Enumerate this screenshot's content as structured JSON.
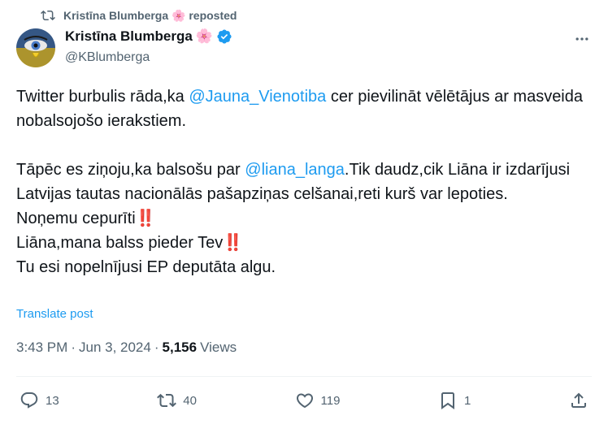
{
  "repost": {
    "text": "Kristīna Blumberga 🌸 reposted",
    "icon": "repost-icon"
  },
  "author": {
    "name": "Kristīna Blumberga",
    "name_emoji": "🌸",
    "verified_icon": "verified-badge-icon",
    "handle": "@KBlumberga"
  },
  "tweet": {
    "line1_a": "Twitter burbulis rāda,ka ",
    "mention1": "@Jauna_Vienotiba",
    "line1_b": " cer pievilināt vēlētājus ar masveida nobalsojošo ierakstiem.",
    "line2_a": "Tāpēc es ziņoju,ka balsošu par ",
    "mention2": "@liana_langa",
    "line2_b": ".Tik daudz,cik Liāna ir izdarījusi Latvijas tautas nacionālās pašapziņas celšanai,reti kurš var lepoties.",
    "line3": "Noņemu cepurīti",
    "line4": "Liāna,mana balss pieder Tev",
    "line5": "Tu esi nopelnījusi EP deputāta algu.",
    "emphasis": "‼️"
  },
  "translate_label": "Translate post",
  "meta": {
    "time": "3:43 PM",
    "sep": "·",
    "date": "Jun 3, 2024",
    "views_count": "5,156",
    "views_label": "Views"
  },
  "actions": {
    "replies": "13",
    "reposts": "40",
    "likes": "119",
    "bookmarks": "1"
  },
  "colors": {
    "accent": "#1d9bf0",
    "secondary_text": "#536471",
    "primary_text": "#0f1419"
  }
}
